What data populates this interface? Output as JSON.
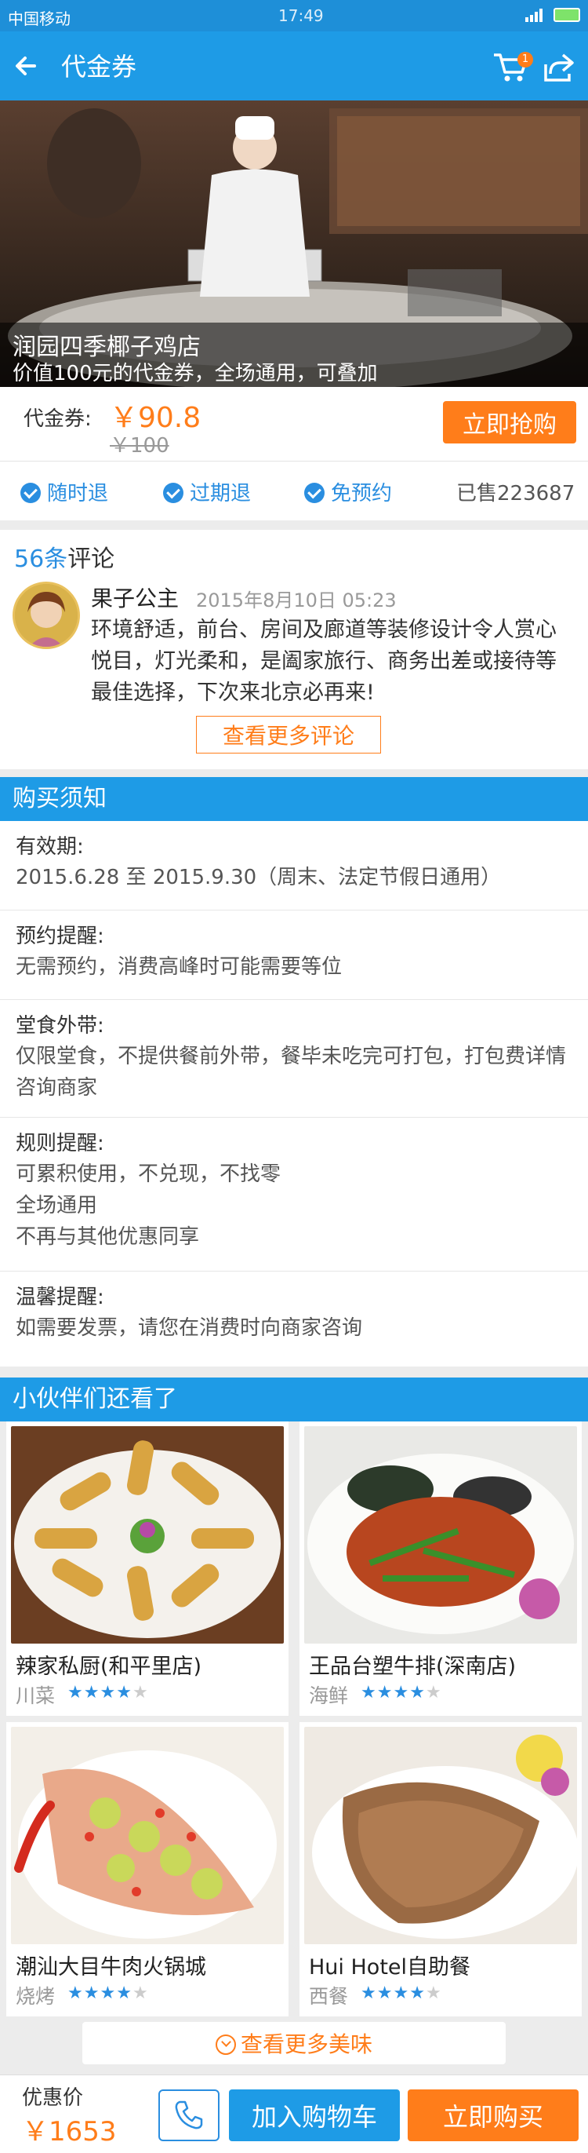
{
  "status_bar": {
    "carrier": "中国移动",
    "time": "17:49"
  },
  "header": {
    "title": "代金券",
    "cart_count": "1"
  },
  "hero": {
    "store_name": "润园四季椰子鸡店",
    "description": "价值100元的代金券，全场通用，可叠加"
  },
  "price": {
    "label": "代金券:",
    "current": "￥90.8",
    "original": "￥100",
    "buy_label": "立即抢购"
  },
  "tags": [
    "随时退",
    "过期退",
    "免预约"
  ],
  "sold": "已售223687",
  "reviews": {
    "count": "56条",
    "count_suffix": "评论",
    "user": "果子公主",
    "date": "2015年8月10日  05:23",
    "text": "环境舒适，前台、房间及廊道等装修设计令人赏心悦目，灯光柔和，是阖家旅行、商务出差或接待等最佳选择，下次来北京必再来!",
    "more_label": "查看更多评论"
  },
  "notice": {
    "title": "购买须知",
    "items": [
      {
        "heading": "有效期:",
        "body": "2015.6.28 至 2015.9.30（周末、法定节假日通用）"
      },
      {
        "heading": "预约提醒:",
        "body": "无需预约，消费高峰时可能需要等位"
      },
      {
        "heading": "堂食外带:",
        "body": "仅限堂食，不提供餐前外带，餐毕未吃完可打包，打包费详情咨询商家"
      },
      {
        "heading": "规则提醒:",
        "lines": [
          "可累积使用，不兑现，不找零",
          "全场通用",
          "不再与其他优惠同享"
        ]
      },
      {
        "heading": "温馨提醒:",
        "body": "如需要发票，请您在消费时向商家咨询"
      }
    ]
  },
  "partners": {
    "title": "小伙伴们还看了",
    "items": [
      {
        "name": "辣家私厨(和平里店)",
        "category": "川菜",
        "rating": 3.5
      },
      {
        "name": "王品台塑牛排(深南店)",
        "category": "海鲜",
        "rating": 3.5
      },
      {
        "name": "潮汕大目牛肉火锅城",
        "category": "烧烤",
        "rating": 3.5
      },
      {
        "name": "Hui Hotel自助餐",
        "category": "西餐",
        "rating": 3.5
      }
    ],
    "more_label": "查看更多美味"
  },
  "bottom": {
    "price_label": "优惠价",
    "price": "￥1653",
    "cart_label": "加入购物车",
    "buy_label": "立即购买"
  },
  "colors": {
    "primary_blue": "#1e9be6",
    "accent_orange": "#ff7d1a"
  },
  "icons": [
    "back-arrow-icon",
    "cart-icon",
    "share-icon",
    "check-icon",
    "phone-icon",
    "chevron-down-icon",
    "star-icon"
  ]
}
